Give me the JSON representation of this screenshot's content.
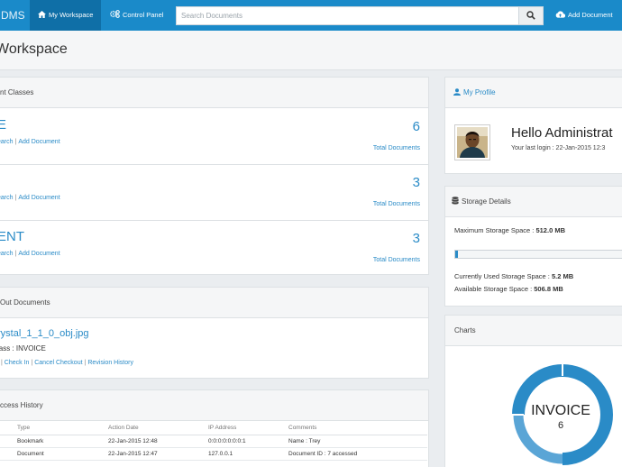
{
  "nav": {
    "brand": "DMS",
    "workspace_tab": "My Workspace",
    "control_tab": "Control Panel",
    "search_placeholder": "Search Documents",
    "add_document": "Add Document"
  },
  "page": {
    "title": "Workspace"
  },
  "classes": {
    "heading": "nt Classes",
    "rows": [
      {
        "name": "E",
        "search": "earch",
        "add": "Add Document",
        "count": "6",
        "total_label": "Total Documents"
      },
      {
        "name": "",
        "search": "earch",
        "add": "Add Document",
        "count": "3",
        "total_label": "Total Documents"
      },
      {
        "name": "ENT",
        "search": "earch",
        "add": "Add Document",
        "count": "3",
        "total_label": "Total Documents"
      }
    ]
  },
  "checked_out": {
    "heading": "Out Documents",
    "file": "rystal_1_1_0_obj.jpg",
    "class_label": "lass : INVOICE",
    "links": {
      "first": "t",
      "checkin": "Check In",
      "cancel": "Cancel Checkout",
      "revision": "Revision History"
    }
  },
  "access": {
    "heading": "ccess History",
    "columns": [
      "Type",
      "Action Date",
      "IP Address",
      "Comments"
    ],
    "rows": [
      {
        "type": "Bookmark",
        "date": "22-Jan-2015 12:48",
        "ip": "0:0:0:0:0:0:0:1",
        "comment": "Name : Trey"
      },
      {
        "type": "Document",
        "date": "22-Jan-2015 12:47",
        "ip": "127.0.0.1",
        "comment": "Document ID : 7 accessed"
      }
    ]
  },
  "profile": {
    "heading": "My Profile",
    "hello": "Hello Administrat",
    "last_login": "Your last login : 22-Jan-2015 12:3"
  },
  "storage": {
    "heading": "Storage Details",
    "max_label": "Maximum Storage Space : ",
    "max_value": "512.0 MB",
    "used_label": "Currently Used Storage Space : ",
    "used_value": "5.2 MB",
    "avail_label": "Available Storage Space : ",
    "avail_value": "506.8 MB",
    "used_fraction": 0.0102
  },
  "charts": {
    "heading": "Charts",
    "center_label": "INVOICE",
    "center_value": "6",
    "accent": "#2a8bc7",
    "light": "#5aa5d6"
  }
}
